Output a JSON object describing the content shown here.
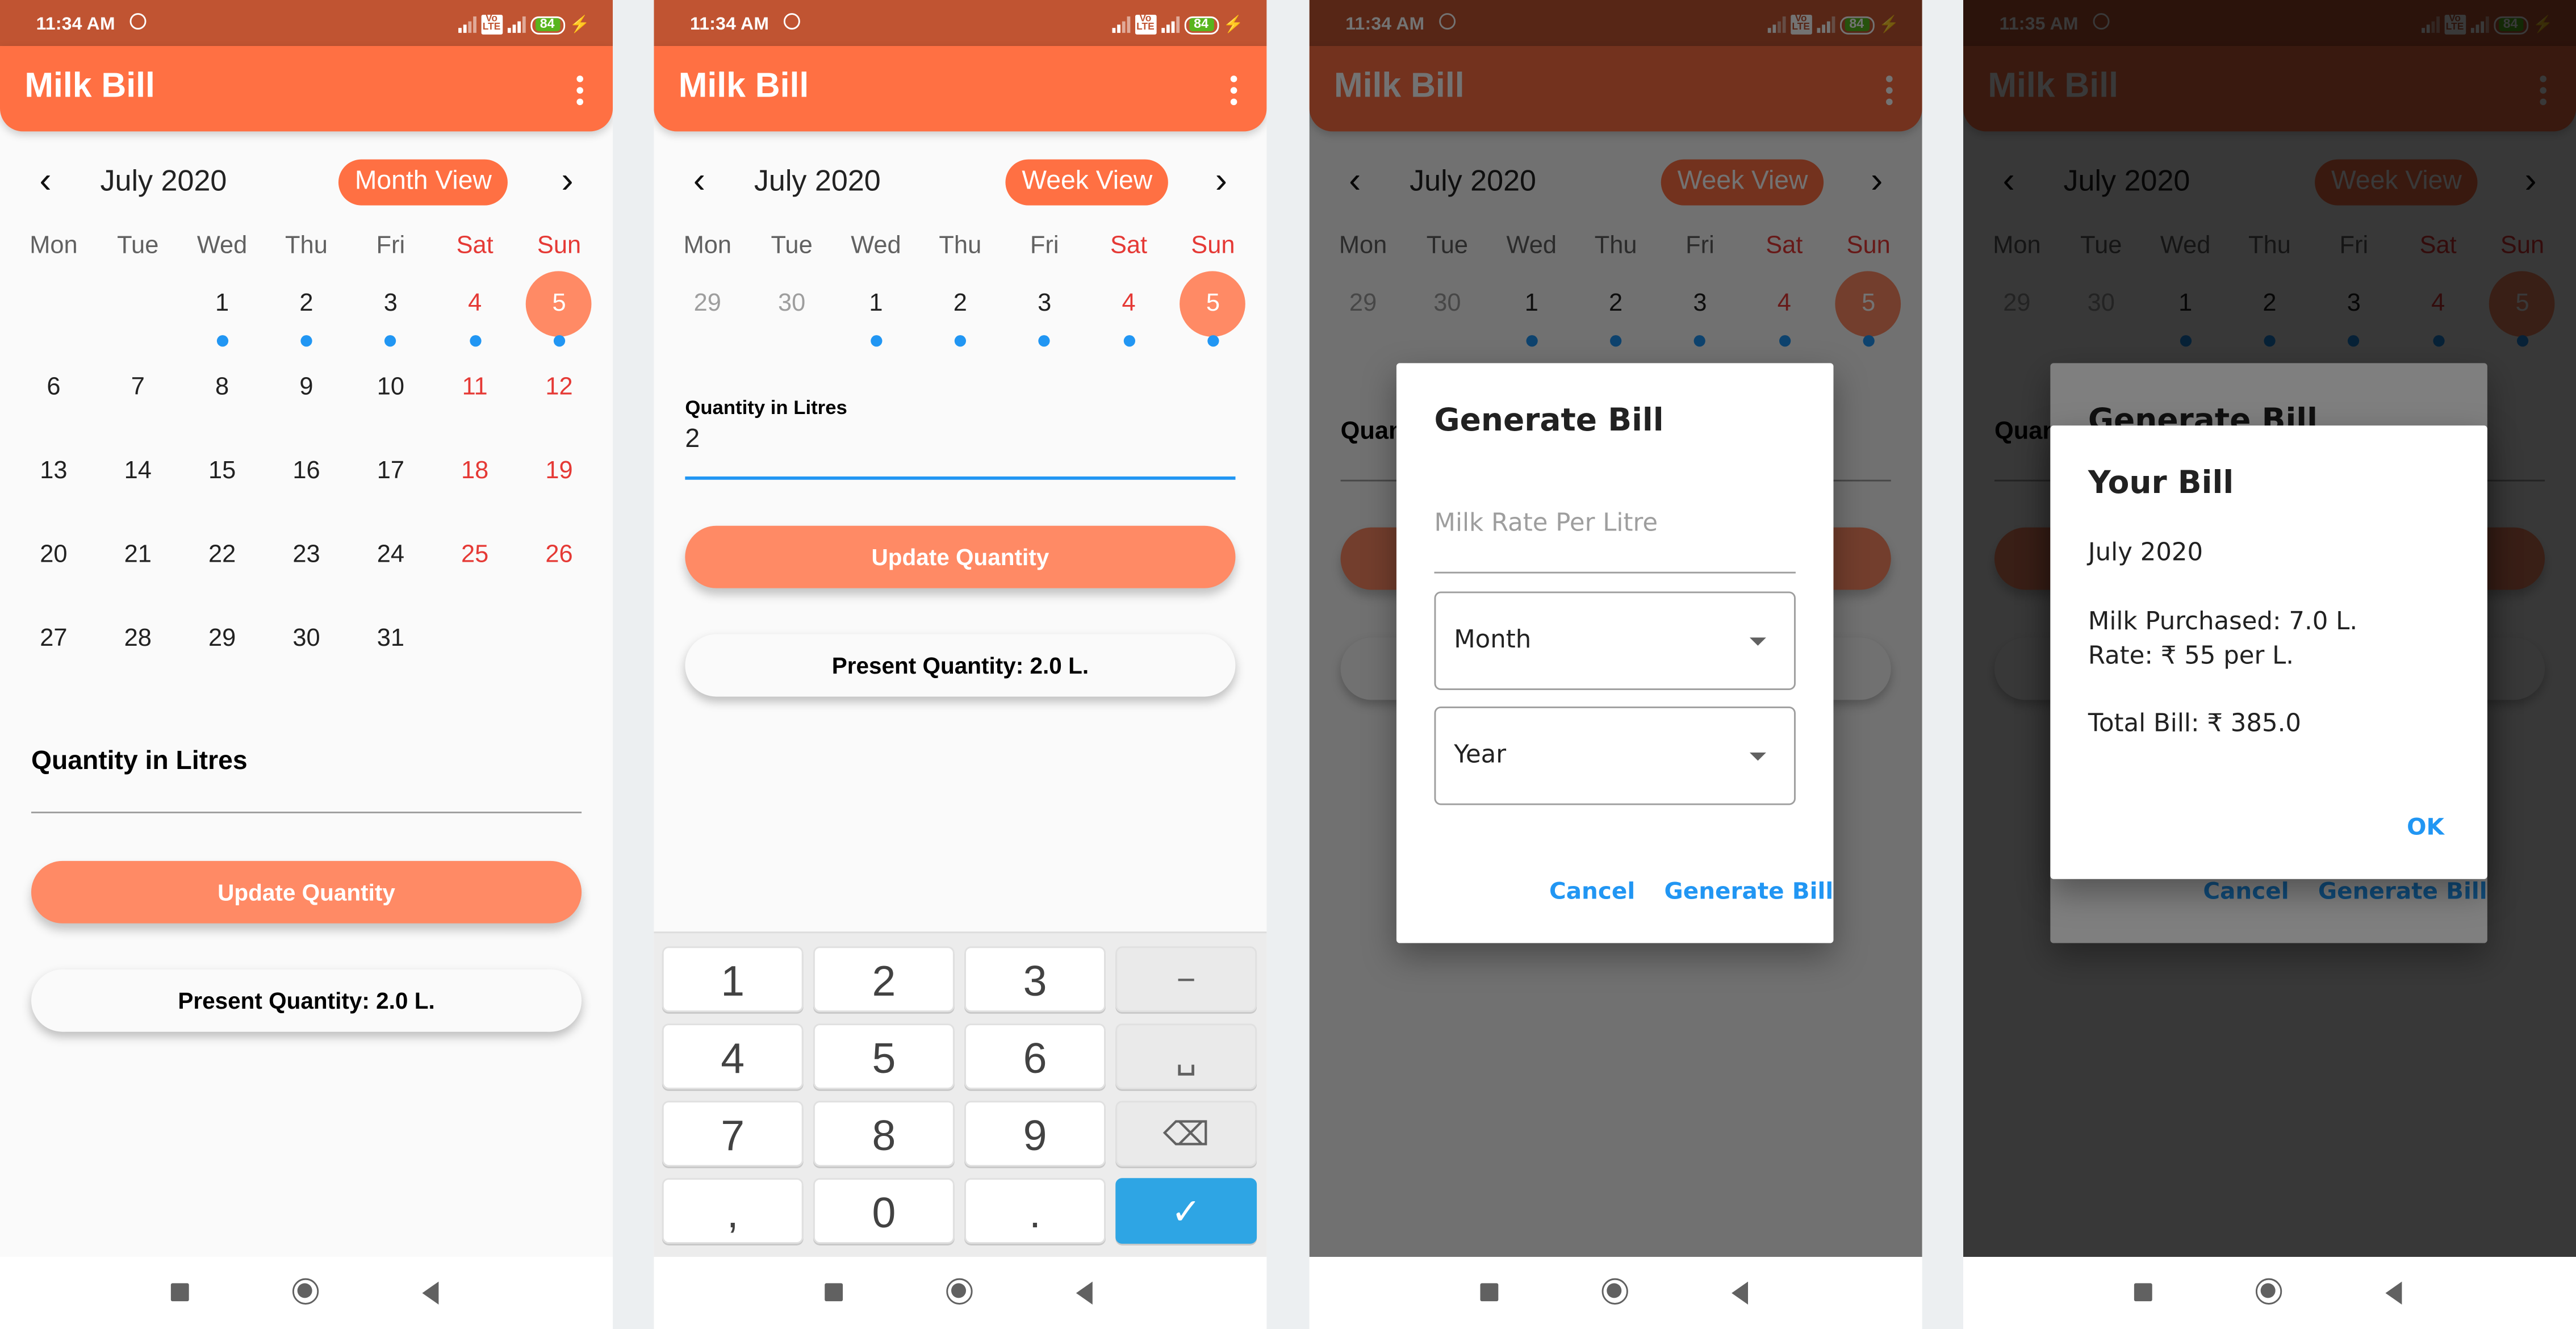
{
  "app": {
    "title": "Milk Bill",
    "accent": "#ff7043",
    "selected_day_color": "#ff8a65",
    "event_dot_color": "#2196f3"
  },
  "status_bar": {
    "battery": "84",
    "screens": [
      "11:34 AM",
      "11:34 AM",
      "11:34 AM",
      "11:35 AM"
    ]
  },
  "calendar": {
    "month_label": "July 2020",
    "weekdays": [
      "Mon",
      "Tue",
      "Wed",
      "Thu",
      "Fri",
      "Sat",
      "Sun"
    ],
    "month_view_label": "Month View",
    "week_view_label": "Week View",
    "month_weeks": [
      [
        "",
        "",
        "1",
        "2",
        "3",
        "4",
        "5"
      ],
      [
        "6",
        "7",
        "8",
        "9",
        "10",
        "11",
        "12"
      ],
      [
        "13",
        "14",
        "15",
        "16",
        "17",
        "18",
        "19"
      ],
      [
        "20",
        "21",
        "22",
        "23",
        "24",
        "25",
        "26"
      ],
      [
        "27",
        "28",
        "29",
        "30",
        "31",
        "",
        ""
      ]
    ],
    "week_days": [
      "29",
      "30",
      "1",
      "2",
      "3",
      "4",
      "5"
    ],
    "selected_day": "5",
    "days_with_entries": [
      "1",
      "2",
      "3",
      "4",
      "5"
    ]
  },
  "quantity": {
    "label": "Quantity in Litres",
    "value_screen2": "2",
    "update_button": "Update Quantity",
    "present_label": "Present Quantity: 2.0 L."
  },
  "keyboard": {
    "keys": [
      "1",
      "2",
      "3",
      "−",
      "4",
      "5",
      "6",
      "␣",
      "7",
      "8",
      "9",
      "⌫",
      ",",
      "0",
      ".",
      "✓"
    ]
  },
  "generate_dialog": {
    "title": "Generate Bill",
    "rate_placeholder": "Milk Rate Per Litre",
    "month_dropdown": "Month",
    "year_dropdown": "Year",
    "cancel_button": "Cancel",
    "generate_button": "Generate Bill"
  },
  "bill_dialog": {
    "title": "Your Bill",
    "period": "July  2020",
    "milk_purchased": "Milk Purchased: 7.0 L.",
    "rate": "Rate: ₹ 55 per L.",
    "total": "Total Bill: ₹ 385.0",
    "ok_button": "OK"
  }
}
